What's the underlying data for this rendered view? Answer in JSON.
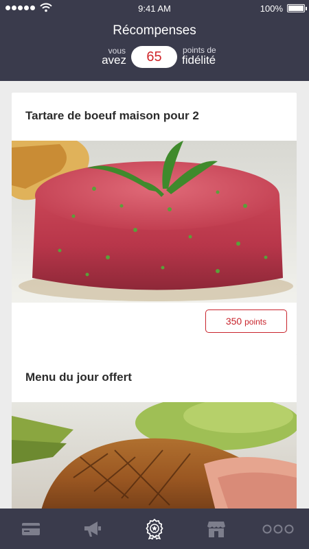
{
  "status_bar": {
    "time": "9:41 AM",
    "battery": "100%"
  },
  "header": {
    "title": "Récompenses",
    "prefix_small": "vous",
    "prefix_large": "avez",
    "points": "65",
    "suffix_small": "points de",
    "suffix_large": "fidélité"
  },
  "rewards": [
    {
      "title": "Tartare de boeuf maison pour 2",
      "cost": "350",
      "cost_unit": "points",
      "image": "beef-tartare-photo"
    },
    {
      "title": "Menu du jour offert",
      "image": "roast-ham-photo"
    }
  ],
  "tabbar": {
    "items": [
      {
        "icon": "card-icon",
        "active": false
      },
      {
        "icon": "megaphone-icon",
        "active": false
      },
      {
        "icon": "award-icon",
        "active": true
      },
      {
        "icon": "store-icon",
        "active": false
      },
      {
        "icon": "more-icon",
        "active": false
      }
    ]
  },
  "colors": {
    "header_bg": "#3a3b4c",
    "accent": "#c8232b",
    "background": "#ececec"
  }
}
